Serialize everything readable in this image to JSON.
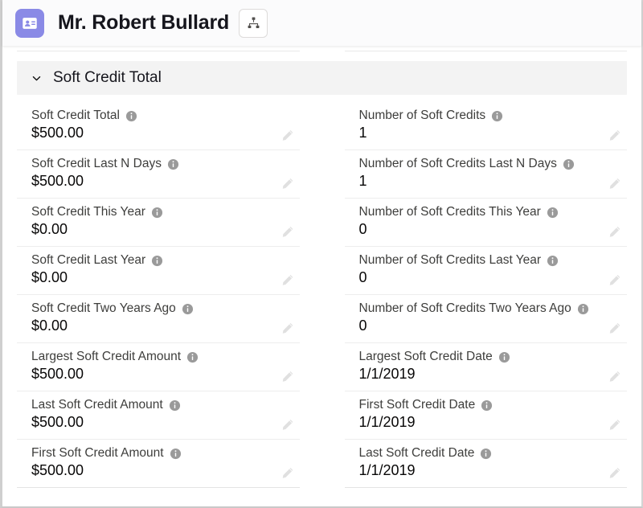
{
  "header": {
    "entity_icon": "contact-card-icon",
    "entity_icon_color": "#8a8ae6",
    "title": "Mr. Robert Bullard",
    "hierarchy_button_icon": "hierarchy-icon"
  },
  "section": {
    "title": "Soft Credit Total",
    "collapse_icon": "chevron-down-icon",
    "expanded": true
  },
  "fields": {
    "left": [
      {
        "label": "Soft Credit Total",
        "value": "$500.00",
        "info_icon": "info-icon",
        "edit_icon": "pencil-icon"
      },
      {
        "label": "Soft Credit Last N Days",
        "value": "$500.00",
        "info_icon": "info-icon",
        "edit_icon": "pencil-icon"
      },
      {
        "label": "Soft Credit This Year",
        "value": "$0.00",
        "info_icon": "info-icon",
        "edit_icon": "pencil-icon"
      },
      {
        "label": "Soft Credit Last Year",
        "value": "$0.00",
        "info_icon": "info-icon",
        "edit_icon": "pencil-icon"
      },
      {
        "label": "Soft Credit Two Years Ago",
        "value": "$0.00",
        "info_icon": "info-icon",
        "edit_icon": "pencil-icon"
      },
      {
        "label": "Largest Soft Credit Amount",
        "value": "$500.00",
        "info_icon": "info-icon",
        "edit_icon": "pencil-icon"
      },
      {
        "label": "Last Soft Credit Amount",
        "value": "$500.00",
        "info_icon": "info-icon",
        "edit_icon": "pencil-icon"
      },
      {
        "label": "First Soft Credit Amount",
        "value": "$500.00",
        "info_icon": "info-icon",
        "edit_icon": "pencil-icon"
      }
    ],
    "right": [
      {
        "label": "Number of Soft Credits",
        "value": "1",
        "info_icon": "info-icon",
        "edit_icon": "pencil-icon"
      },
      {
        "label": "Number of Soft Credits Last N Days",
        "value": "1",
        "info_icon": "info-icon",
        "edit_icon": "pencil-icon"
      },
      {
        "label": "Number of Soft Credits This Year",
        "value": "0",
        "info_icon": "info-icon",
        "edit_icon": "pencil-icon"
      },
      {
        "label": "Number of Soft Credits Last Year",
        "value": "0",
        "info_icon": "info-icon",
        "edit_icon": "pencil-icon"
      },
      {
        "label": "Number of Soft Credits Two Years Ago",
        "value": "0",
        "info_icon": "info-icon",
        "edit_icon": "pencil-icon"
      },
      {
        "label": "Largest Soft Credit Date",
        "value": "1/1/2019",
        "info_icon": "info-icon",
        "edit_icon": "pencil-icon"
      },
      {
        "label": "First Soft Credit Date",
        "value": "1/1/2019",
        "info_icon": "info-icon",
        "edit_icon": "pencil-icon"
      },
      {
        "label": "Last Soft Credit Date",
        "value": "1/1/2019",
        "info_icon": "info-icon",
        "edit_icon": "pencil-icon"
      }
    ]
  },
  "colors": {
    "accent": "#8a8ae6",
    "section_band": "#f3f3f3",
    "label_text": "#3e3e3c",
    "value_text": "#080707",
    "row_divider": "#ededed"
  }
}
